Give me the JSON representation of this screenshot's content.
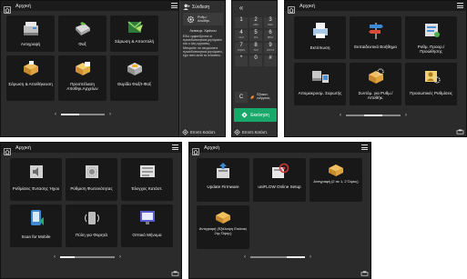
{
  "screen1": {
    "title": "Αρχική",
    "tiles": [
      {
        "label": "Αντιγραφή",
        "icon": "copy-machine-icon"
      },
      {
        "label": "Φαξ",
        "icon": "fax-icon"
      },
      {
        "label": "Σάρωση & Αποστολή",
        "icon": "scan-send-icon"
      },
      {
        "label": "Σάρωση & Αποθήκευση",
        "icon": "scan-store-icon"
      },
      {
        "label": "Προσπέλαση Αποθηκ.Αρχείων",
        "icon": "stored-files-icon"
      },
      {
        "label": "Θυρίδα Φαξ/Ι-Φαξ",
        "icon": "fax-inbox-icon"
      }
    ],
    "side": {
      "login": "Σύνδεση",
      "settings": "Ρυθμ./ Αποθήκ.",
      "sleep_title": "Λειτουρ. Χρόνου",
      "sleep_text": "Εδώ εμφανίζονται οι προειδοποιητικά μηνύματα και ο όλη εργασίες. Μπορείτε να ακυρώσετε προειδοποιητικά μηνύματα, έχει από αυτό το απόσπα.",
      "monitor": "Εποπτ.Κατάστ."
    }
  },
  "keypad": {
    "keys": [
      {
        "n": "1",
        "s": ""
      },
      {
        "n": "2",
        "s": "ABC"
      },
      {
        "n": "3",
        "s": "DEF"
      },
      {
        "n": "4",
        "s": "GHI"
      },
      {
        "n": "5",
        "s": "JKL"
      },
      {
        "n": "6",
        "s": "MNO"
      },
      {
        "n": "7",
        "s": "PQRS"
      },
      {
        "n": "8",
        "s": "TUV"
      },
      {
        "n": "9",
        "s": "WXYZ"
      },
      {
        "n": "*",
        "s": ""
      },
      {
        "n": "0",
        "s": ""
      },
      {
        "n": "#",
        "s": ""
      }
    ],
    "clear": "C",
    "energy": "Εξοικον. ενέργειας",
    "start": "Εκκίνηση",
    "monitor": "Εποπτ.Κατάστ."
  },
  "screen2": {
    "title": "Αρχική",
    "tiles": [
      {
        "label": "Εκτύπωση",
        "icon": "print-icon"
      },
      {
        "label": "Εκπαιδευτικό Βοήθημα",
        "icon": "tutorial-signpost-icon"
      },
      {
        "label": "Ρυθμ. Προορ./ Προώθησης",
        "icon": "destination-settings-icon"
      },
      {
        "label": "Απομακρυσμ. Σαρωτής",
        "icon": "remote-scanner-icon"
      },
      {
        "label": "Συντόμ. για Ρυθμ./Αποθήκ.",
        "icon": "settings-shortcut-icon"
      },
      {
        "label": "Προσωπικές Ρυθμίσεις",
        "icon": "personal-settings-icon"
      }
    ]
  },
  "screen3": {
    "title": "Αρχική",
    "tiles": [
      {
        "label": "Ρυθμίσεις Έντασης Ήχου",
        "icon": "volume-icon"
      },
      {
        "label": "Ρύθμιση Φωτεινότητας",
        "icon": "brightness-icon"
      },
      {
        "label": "Έλεγχος Κατάστ.",
        "icon": "status-monitor-icon"
      },
      {
        "label": "Scan for Mobile",
        "icon": "scan-mobile-icon"
      },
      {
        "label": "Πύλη για Φορητά",
        "icon": "mobile-portal-icon"
      },
      {
        "label": "Οπτικό Μήνυμα",
        "icon": "visual-message-icon"
      }
    ]
  },
  "screen4": {
    "title": "Αρχική",
    "tiles": [
      {
        "label": "Update Firmware",
        "icon": "update-firmware-icon"
      },
      {
        "label": "uniFLOW Online Setup",
        "icon": "uniflow-setup-icon"
      },
      {
        "label": "Αντιγραφή (2 σε 1, 2 Όψεις)",
        "icon": "copy-2on1-icon"
      },
      {
        "label": "Αντιγραφή (Εξάλειψη Εικόνας 2ης Όψης)",
        "icon": "copy-erase-icon"
      }
    ]
  },
  "colors": {
    "accent_green": "#18a86a",
    "panel": "#2b2b2b",
    "tile": "#181818"
  }
}
